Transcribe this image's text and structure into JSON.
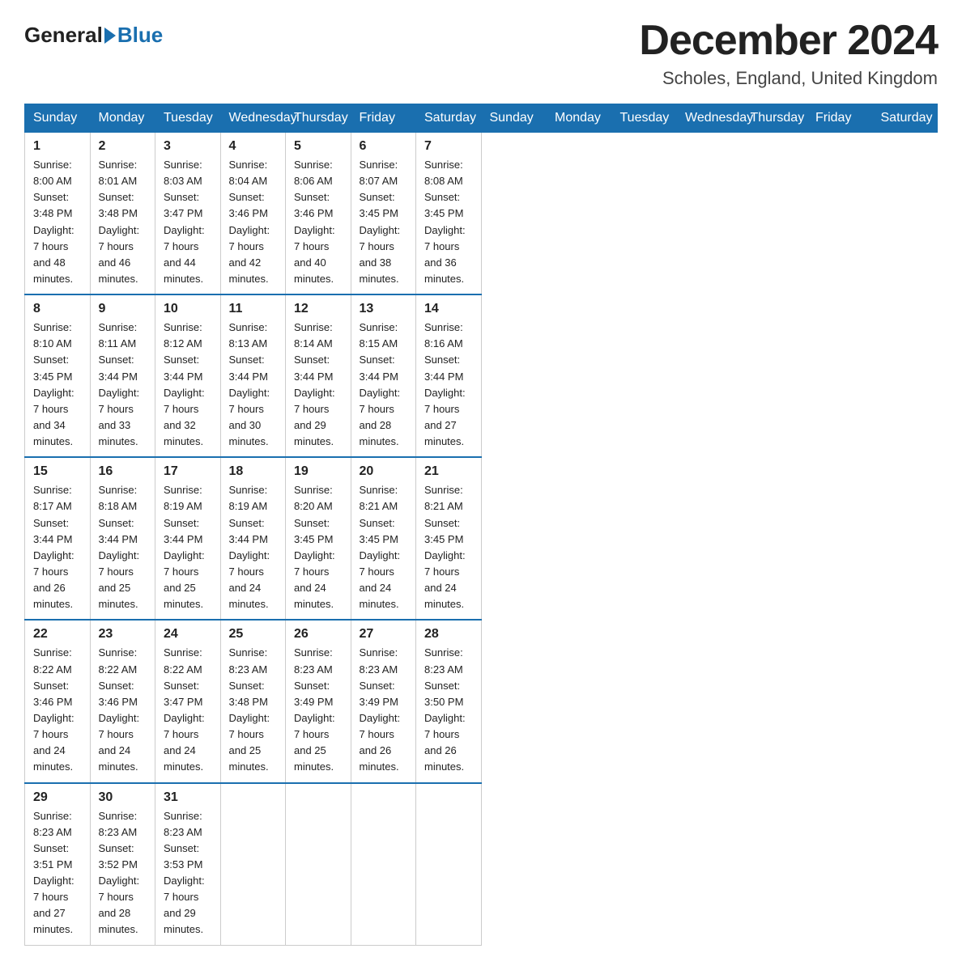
{
  "header": {
    "logo_general": "General",
    "logo_blue": "Blue",
    "month_title": "December 2024",
    "location": "Scholes, England, United Kingdom"
  },
  "weekdays": [
    "Sunday",
    "Monday",
    "Tuesday",
    "Wednesday",
    "Thursday",
    "Friday",
    "Saturday"
  ],
  "weeks": [
    [
      {
        "day": "1",
        "sunrise": "Sunrise: 8:00 AM",
        "sunset": "Sunset: 3:48 PM",
        "daylight": "Daylight: 7 hours",
        "minutes": "and 48 minutes."
      },
      {
        "day": "2",
        "sunrise": "Sunrise: 8:01 AM",
        "sunset": "Sunset: 3:48 PM",
        "daylight": "Daylight: 7 hours",
        "minutes": "and 46 minutes."
      },
      {
        "day": "3",
        "sunrise": "Sunrise: 8:03 AM",
        "sunset": "Sunset: 3:47 PM",
        "daylight": "Daylight: 7 hours",
        "minutes": "and 44 minutes."
      },
      {
        "day": "4",
        "sunrise": "Sunrise: 8:04 AM",
        "sunset": "Sunset: 3:46 PM",
        "daylight": "Daylight: 7 hours",
        "minutes": "and 42 minutes."
      },
      {
        "day": "5",
        "sunrise": "Sunrise: 8:06 AM",
        "sunset": "Sunset: 3:46 PM",
        "daylight": "Daylight: 7 hours",
        "minutes": "and 40 minutes."
      },
      {
        "day": "6",
        "sunrise": "Sunrise: 8:07 AM",
        "sunset": "Sunset: 3:45 PM",
        "daylight": "Daylight: 7 hours",
        "minutes": "and 38 minutes."
      },
      {
        "day": "7",
        "sunrise": "Sunrise: 8:08 AM",
        "sunset": "Sunset: 3:45 PM",
        "daylight": "Daylight: 7 hours",
        "minutes": "and 36 minutes."
      }
    ],
    [
      {
        "day": "8",
        "sunrise": "Sunrise: 8:10 AM",
        "sunset": "Sunset: 3:45 PM",
        "daylight": "Daylight: 7 hours",
        "minutes": "and 34 minutes."
      },
      {
        "day": "9",
        "sunrise": "Sunrise: 8:11 AM",
        "sunset": "Sunset: 3:44 PM",
        "daylight": "Daylight: 7 hours",
        "minutes": "and 33 minutes."
      },
      {
        "day": "10",
        "sunrise": "Sunrise: 8:12 AM",
        "sunset": "Sunset: 3:44 PM",
        "daylight": "Daylight: 7 hours",
        "minutes": "and 32 minutes."
      },
      {
        "day": "11",
        "sunrise": "Sunrise: 8:13 AM",
        "sunset": "Sunset: 3:44 PM",
        "daylight": "Daylight: 7 hours",
        "minutes": "and 30 minutes."
      },
      {
        "day": "12",
        "sunrise": "Sunrise: 8:14 AM",
        "sunset": "Sunset: 3:44 PM",
        "daylight": "Daylight: 7 hours",
        "minutes": "and 29 minutes."
      },
      {
        "day": "13",
        "sunrise": "Sunrise: 8:15 AM",
        "sunset": "Sunset: 3:44 PM",
        "daylight": "Daylight: 7 hours",
        "minutes": "and 28 minutes."
      },
      {
        "day": "14",
        "sunrise": "Sunrise: 8:16 AM",
        "sunset": "Sunset: 3:44 PM",
        "daylight": "Daylight: 7 hours",
        "minutes": "and 27 minutes."
      }
    ],
    [
      {
        "day": "15",
        "sunrise": "Sunrise: 8:17 AM",
        "sunset": "Sunset: 3:44 PM",
        "daylight": "Daylight: 7 hours",
        "minutes": "and 26 minutes."
      },
      {
        "day": "16",
        "sunrise": "Sunrise: 8:18 AM",
        "sunset": "Sunset: 3:44 PM",
        "daylight": "Daylight: 7 hours",
        "minutes": "and 25 minutes."
      },
      {
        "day": "17",
        "sunrise": "Sunrise: 8:19 AM",
        "sunset": "Sunset: 3:44 PM",
        "daylight": "Daylight: 7 hours",
        "minutes": "and 25 minutes."
      },
      {
        "day": "18",
        "sunrise": "Sunrise: 8:19 AM",
        "sunset": "Sunset: 3:44 PM",
        "daylight": "Daylight: 7 hours",
        "minutes": "and 24 minutes."
      },
      {
        "day": "19",
        "sunrise": "Sunrise: 8:20 AM",
        "sunset": "Sunset: 3:45 PM",
        "daylight": "Daylight: 7 hours",
        "minutes": "and 24 minutes."
      },
      {
        "day": "20",
        "sunrise": "Sunrise: 8:21 AM",
        "sunset": "Sunset: 3:45 PM",
        "daylight": "Daylight: 7 hours",
        "minutes": "and 24 minutes."
      },
      {
        "day": "21",
        "sunrise": "Sunrise: 8:21 AM",
        "sunset": "Sunset: 3:45 PM",
        "daylight": "Daylight: 7 hours",
        "minutes": "and 24 minutes."
      }
    ],
    [
      {
        "day": "22",
        "sunrise": "Sunrise: 8:22 AM",
        "sunset": "Sunset: 3:46 PM",
        "daylight": "Daylight: 7 hours",
        "minutes": "and 24 minutes."
      },
      {
        "day": "23",
        "sunrise": "Sunrise: 8:22 AM",
        "sunset": "Sunset: 3:46 PM",
        "daylight": "Daylight: 7 hours",
        "minutes": "and 24 minutes."
      },
      {
        "day": "24",
        "sunrise": "Sunrise: 8:22 AM",
        "sunset": "Sunset: 3:47 PM",
        "daylight": "Daylight: 7 hours",
        "minutes": "and 24 minutes."
      },
      {
        "day": "25",
        "sunrise": "Sunrise: 8:23 AM",
        "sunset": "Sunset: 3:48 PM",
        "daylight": "Daylight: 7 hours",
        "minutes": "and 25 minutes."
      },
      {
        "day": "26",
        "sunrise": "Sunrise: 8:23 AM",
        "sunset": "Sunset: 3:49 PM",
        "daylight": "Daylight: 7 hours",
        "minutes": "and 25 minutes."
      },
      {
        "day": "27",
        "sunrise": "Sunrise: 8:23 AM",
        "sunset": "Sunset: 3:49 PM",
        "daylight": "Daylight: 7 hours",
        "minutes": "and 26 minutes."
      },
      {
        "day": "28",
        "sunrise": "Sunrise: 8:23 AM",
        "sunset": "Sunset: 3:50 PM",
        "daylight": "Daylight: 7 hours",
        "minutes": "and 26 minutes."
      }
    ],
    [
      {
        "day": "29",
        "sunrise": "Sunrise: 8:23 AM",
        "sunset": "Sunset: 3:51 PM",
        "daylight": "Daylight: 7 hours",
        "minutes": "and 27 minutes."
      },
      {
        "day": "30",
        "sunrise": "Sunrise: 8:23 AM",
        "sunset": "Sunset: 3:52 PM",
        "daylight": "Daylight: 7 hours",
        "minutes": "and 28 minutes."
      },
      {
        "day": "31",
        "sunrise": "Sunrise: 8:23 AM",
        "sunset": "Sunset: 3:53 PM",
        "daylight": "Daylight: 7 hours",
        "minutes": "and 29 minutes."
      },
      null,
      null,
      null,
      null
    ]
  ]
}
